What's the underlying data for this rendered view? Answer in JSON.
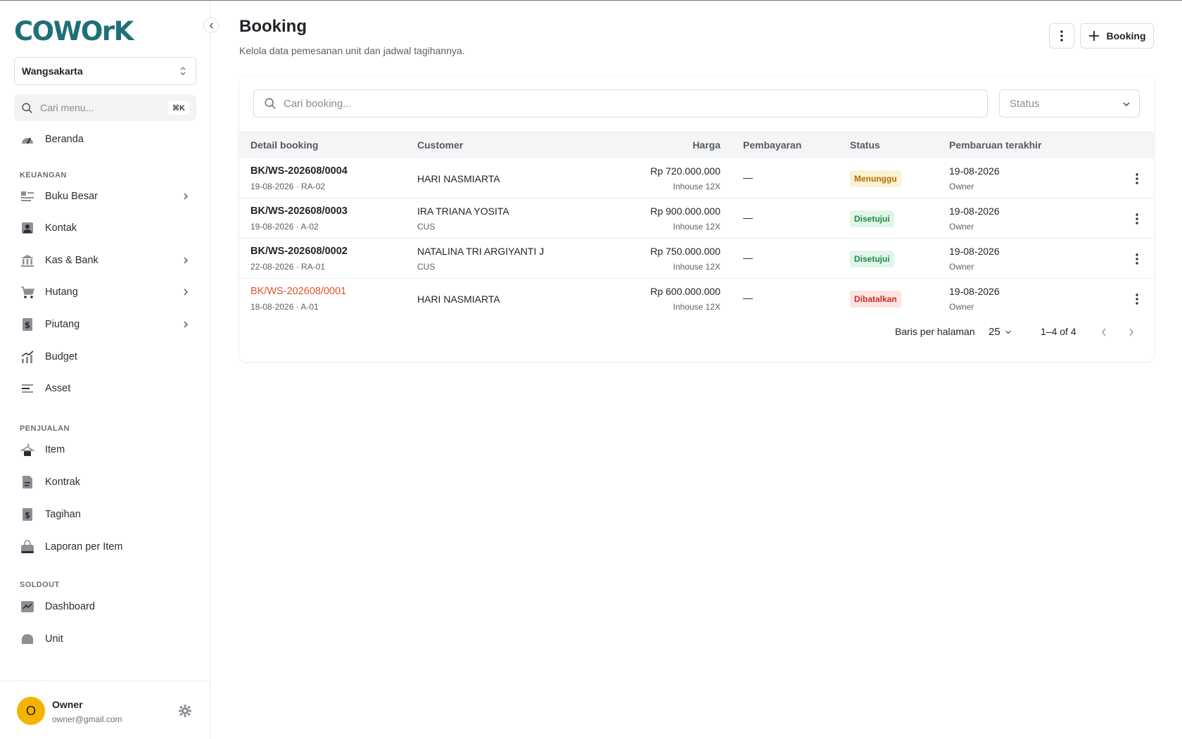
{
  "app": {
    "logo_text": "COWOrK"
  },
  "sidebar": {
    "workspace": "Wangsakarta",
    "search_placeholder": "Cari menu...",
    "search_shortcut": "⌘K",
    "items": [
      {
        "label": "Beranda",
        "icon": "dashboard-gauge-icon",
        "has_children": false
      },
      {
        "section": "KEUANGAN"
      },
      {
        "label": "Buku Besar",
        "icon": "ledger-icon",
        "has_children": true
      },
      {
        "label": "Kontak",
        "icon": "contact-icon",
        "has_children": false
      },
      {
        "label": "Kas & Bank",
        "icon": "bank-icon",
        "has_children": true
      },
      {
        "label": "Hutang",
        "icon": "cart-icon",
        "has_children": true
      },
      {
        "label": "Piutang",
        "icon": "receivable-icon",
        "has_children": true
      },
      {
        "label": "Budget",
        "icon": "budget-chart-icon",
        "has_children": false
      },
      {
        "label": "Asset",
        "icon": "asset-icon",
        "has_children": false
      },
      {
        "section": "PENJUALAN"
      },
      {
        "label": "Item",
        "icon": "item-hanger-icon",
        "has_children": false
      },
      {
        "label": "Kontrak",
        "icon": "contract-icon",
        "has_children": false
      },
      {
        "label": "Tagihan",
        "icon": "invoice-icon",
        "has_children": false
      },
      {
        "label": "Laporan per Item",
        "icon": "report-bag-icon",
        "has_children": false
      },
      {
        "section": "SOLDOUT"
      },
      {
        "label": "Dashboard",
        "icon": "trend-icon",
        "has_children": false
      },
      {
        "label": "Unit",
        "icon": "unit-icon",
        "has_children": false
      }
    ],
    "user": {
      "initial": "O",
      "name": "Owner",
      "email": "owner@gmail.com"
    }
  },
  "header": {
    "title": "Booking",
    "subtitle": "Kelola data pemesanan unit dan jadwal tagihannya.",
    "add_button": "Booking"
  },
  "filters": {
    "search_placeholder": "Cari booking...",
    "status_placeholder": "Status"
  },
  "table": {
    "columns": [
      "Detail booking",
      "Customer",
      "Harga",
      "Pembayaran",
      "Status",
      "Pembaruan terakhir"
    ],
    "rows": [
      {
        "code": "BK/WS-202608/0004",
        "meta": "19-08-2026 · RA-02",
        "customer": "HARI NASMIARTA",
        "customer_sub": "",
        "price": "Rp 720.000.000",
        "price_sub": "Inhouse 12X",
        "payment": "—",
        "status": "Menunggu",
        "status_kind": "wait",
        "updated": "19-08-2026",
        "updated_by": "Owner"
      },
      {
        "code": "BK/WS-202608/0003",
        "meta": "19-08-2026 · A-02",
        "customer": "IRA TRIANA YOSITA",
        "customer_sub": "CUS",
        "price": "Rp 900.000.000",
        "price_sub": "Inhouse 12X",
        "payment": "—",
        "status": "Disetujui",
        "status_kind": "ok",
        "updated": "19-08-2026",
        "updated_by": "Owner"
      },
      {
        "code": "BK/WS-202608/0002",
        "meta": "22-08-2026 · RA-01",
        "customer": "NATALINA TRI ARGIYANTI J",
        "customer_sub": "CUS",
        "price": "Rp 750.000.000",
        "price_sub": "Inhouse 12X",
        "payment": "—",
        "status": "Disetujui",
        "status_kind": "ok",
        "updated": "19-08-2026",
        "updated_by": "Owner"
      },
      {
        "code": "BK/WS-202608/0001",
        "meta": "18-08-2026 · A-01",
        "customer": "HARI NASMIARTA",
        "customer_sub": "",
        "price": "Rp 600.000.000",
        "price_sub": "Inhouse 12X",
        "payment": "—",
        "status": "Dibatalkan",
        "status_kind": "cancel",
        "updated": "19-08-2026",
        "updated_by": "Owner"
      }
    ]
  },
  "pagination": {
    "rows_per_page_label": "Baris per halaman",
    "rows_per_page": "25",
    "range": "1–4 of 4"
  },
  "colors": {
    "brand": "#1f6f78",
    "cancelled_link": "#e0542e",
    "badge_wait": "#fdf1d3",
    "badge_ok": "#e1f5e8",
    "badge_cancel": "#fde4e2",
    "avatar": "#f5b301"
  }
}
